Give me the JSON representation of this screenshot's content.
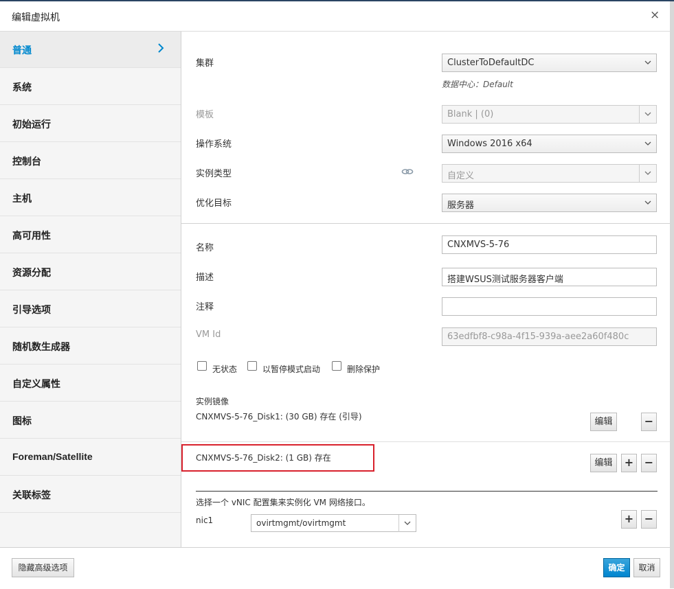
{
  "dialog": {
    "title": "编辑虚拟机",
    "close_glyph": "×"
  },
  "sidebar": {
    "items": [
      {
        "label": "普通",
        "active": true
      },
      {
        "label": "系统"
      },
      {
        "label": "初始运行"
      },
      {
        "label": "控制台"
      },
      {
        "label": "主机"
      },
      {
        "label": "高可用性"
      },
      {
        "label": "资源分配"
      },
      {
        "label": "引导选项"
      },
      {
        "label": "随机数生成器"
      },
      {
        "label": "自定义属性"
      },
      {
        "label": "图标"
      },
      {
        "label": "Foreman/Satellite"
      },
      {
        "label": "关联标签"
      }
    ]
  },
  "general": {
    "cluster": {
      "label": "集群",
      "value": "ClusterToDefaultDC",
      "datacenter_note": "数据中心：Default"
    },
    "template": {
      "label": "模板",
      "value": "Blank |  (0)"
    },
    "os": {
      "label": "操作系统",
      "value": "Windows 2016 x64"
    },
    "instance_type": {
      "label": "实例类型",
      "value": "自定义"
    },
    "optimize": {
      "label": "优化目标",
      "value": "服务器"
    },
    "name": {
      "label": "名称",
      "value": "CNXMVS-5-76"
    },
    "description": {
      "label": "描述",
      "value": "搭建WSUS测试服务器客户端"
    },
    "comment": {
      "label": "注释",
      "value": ""
    },
    "vm_id": {
      "label": "VM Id",
      "value": "63edfbf8-c98a-4f15-939a-aee2a60f480c"
    },
    "checkboxes": {
      "stateless": "无状态",
      "start_paused": "以暂停模式启动",
      "delete_protection": "删除保护"
    },
    "instance_images": {
      "label": "实例镜像",
      "disks": [
        "CNXMVS-5-76_Disk1: (30 GB) 存在 (引导)",
        "CNXMVS-5-76_Disk2: (1 GB) 存在"
      ],
      "edit_label": "编辑",
      "plus": "+",
      "minus": "−"
    },
    "vnic": {
      "instruction": "选择一个 vNIC 配置集来实例化 VM 网络接口。",
      "nic_label": "nic1",
      "nic_value": "ovirtmgmt/ovirtmgmt"
    }
  },
  "footer": {
    "advanced_button": "隐藏高级选项",
    "ok_button": "确定",
    "cancel_button": "取消"
  },
  "colors": {
    "accent": "#0088ce",
    "highlight": "#d8202c",
    "primary_button": "#0085cf"
  }
}
